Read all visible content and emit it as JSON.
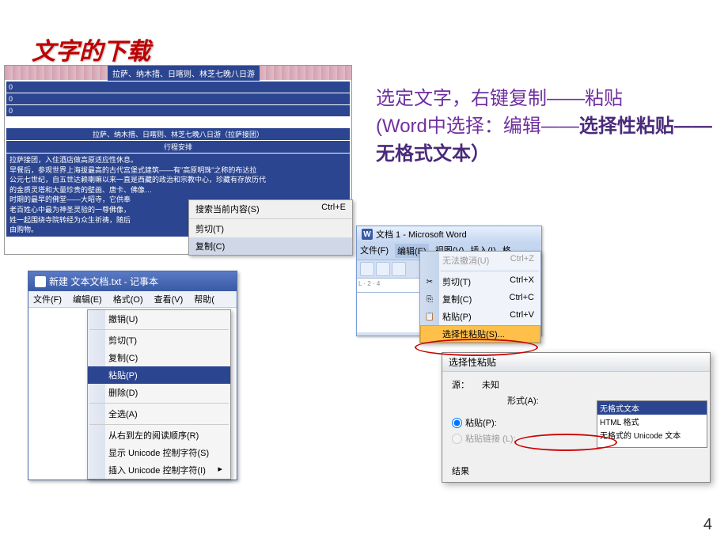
{
  "slide": {
    "title": "文字的下载",
    "page_number": "4"
  },
  "instruction": {
    "line1": "选定文字，右键复制——粘贴",
    "line2a": "(Word中选择：编辑——",
    "line2b": "选择性粘贴",
    "line3a": "——无格式文本）"
  },
  "web": {
    "title1": "拉萨、纳木措、日喀则、林芝七晚八日游",
    "title2": "拉萨、纳木措、日喀则、林芝七晚八日游（拉萨接团）",
    "itinerary_header": "行程安排",
    "row1": "拉萨接团，入住酒店做高原适应性休息。",
    "row2": "早餐后，参观世界上海拔最高的古代宫堡式建筑——有\"高原明珠\"之称的布达拉",
    "row3": "公元七世纪，自五世达赖喇嘛以来一直是西藏的政治和宗教中心，珍藏有存放历代",
    "row4": "的金质灵塔和大量珍贵的壁画、唐卡、佛像…",
    "row5": "时期的最早的佛堂——大昭寺，它供奉",
    "row6": "老百姓心中最为神圣灵验的一尊佛像，",
    "row7": "姓一起围绕寺院转经为众生祈祷，随后",
    "row8": "由购物。"
  },
  "browser_menu": {
    "search": "搜索当前内容(S)",
    "search_shortcut": "Ctrl+E",
    "cut": "剪切(T)",
    "copy": "复制(C)"
  },
  "notepad": {
    "title": "新建 文本文档.txt - 记事本",
    "menu": {
      "file": "文件(F)",
      "edit": "编辑(E)",
      "format": "格式(O)",
      "view": "查看(V)",
      "help": "帮助("
    }
  },
  "context_menu": {
    "undo": "撤销(U)",
    "cut": "剪切(T)",
    "copy": "复制(C)",
    "paste": "粘贴(P)",
    "delete": "删除(D)",
    "select_all": "全选(A)",
    "rtl": "从右到左的阅读顺序(R)",
    "show_unicode": "显示 Unicode 控制字符(S)",
    "insert_unicode": "插入 Unicode 控制字符(I)"
  },
  "word": {
    "title": "文档 1 - Microsoft Word",
    "menu": {
      "file": "文件(F)",
      "edit": "编辑(E)",
      "view": "视图(V)",
      "insert": "插入(I)",
      "format": "格"
    }
  },
  "edit_menu": {
    "undo": "无法撤消(U)",
    "undo_sc": "Ctrl+Z",
    "cut": "剪切(T)",
    "cut_sc": "Ctrl+X",
    "copy": "复制(C)",
    "copy_sc": "Ctrl+C",
    "paste": "粘贴(P)",
    "paste_sc": "Ctrl+V",
    "paste_special": "选择性粘贴(S)..."
  },
  "paste_dialog": {
    "title": "选择性粘贴",
    "source_label": "源：",
    "source_value": "未知",
    "paste_radio": "粘贴(P):",
    "paste_link_radio": "粘贴链接 (L):",
    "format_label": "形式(A):",
    "list": {
      "unformatted": "无格式文本",
      "html": "HTML 格式",
      "unicode": "无格式的 Unicode 文本"
    },
    "result_label": "结果"
  }
}
